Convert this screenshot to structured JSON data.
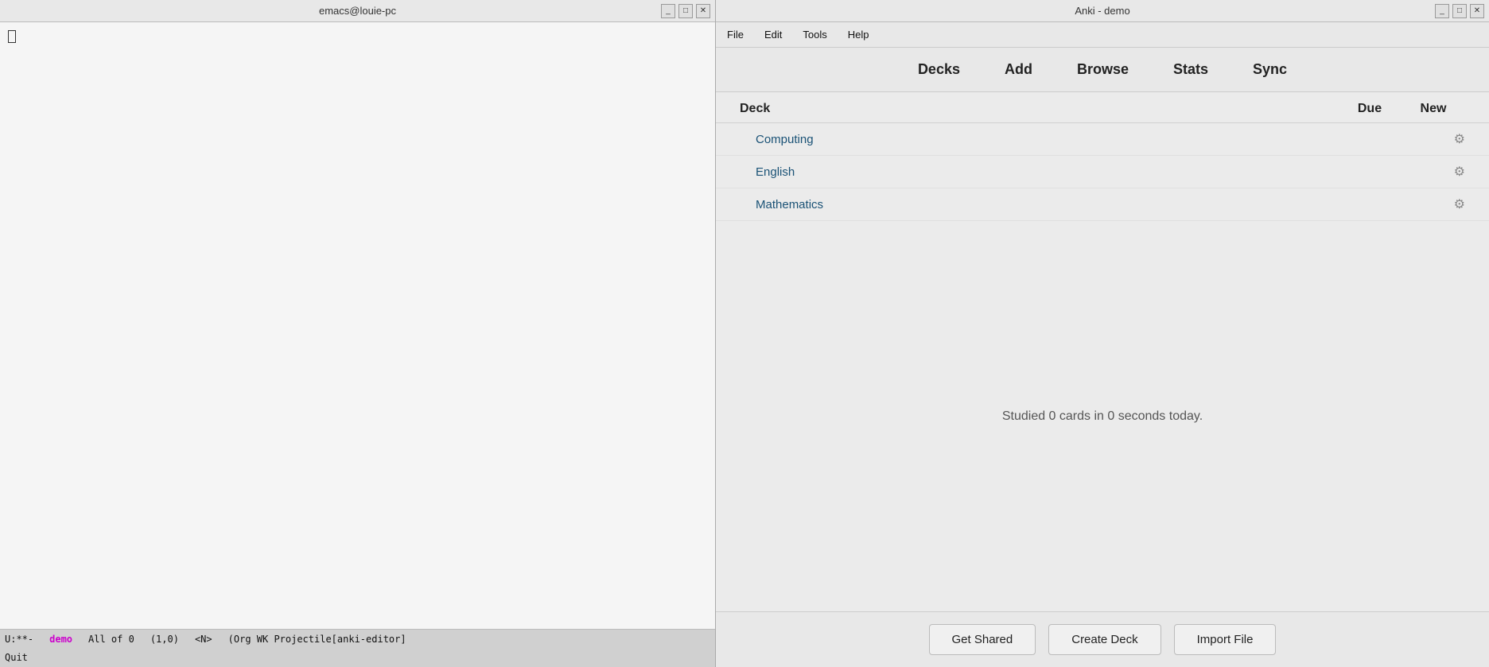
{
  "emacs": {
    "title": "emacs@louie-pc",
    "controls": [
      "_",
      "□",
      "✕"
    ],
    "statusbar": {
      "mode": "U:**-",
      "buffer": "demo",
      "position": "All of 0",
      "coords": "(1,0)",
      "extra": "<N>",
      "mode_info": "(Org WK Projectile[anki-editor]"
    },
    "quit_label": "Quit"
  },
  "anki": {
    "title": "Anki - demo",
    "controls": [
      "_",
      "□",
      "✕"
    ],
    "menu": {
      "items": [
        "File",
        "Edit",
        "Tools",
        "Help"
      ]
    },
    "toolbar": {
      "items": [
        "Decks",
        "Add",
        "Browse",
        "Stats",
        "Sync"
      ]
    },
    "deck_header": {
      "name": "Deck",
      "due": "Due",
      "new": "New"
    },
    "decks": [
      {
        "name": "Computing",
        "due": "",
        "new": ""
      },
      {
        "name": "English",
        "due": "",
        "new": ""
      },
      {
        "name": "Mathematics",
        "due": "",
        "new": ""
      }
    ],
    "studied_text": "Studied 0 cards in 0 seconds today.",
    "footer": {
      "buttons": [
        "Get Shared",
        "Create Deck",
        "Import File"
      ]
    }
  }
}
